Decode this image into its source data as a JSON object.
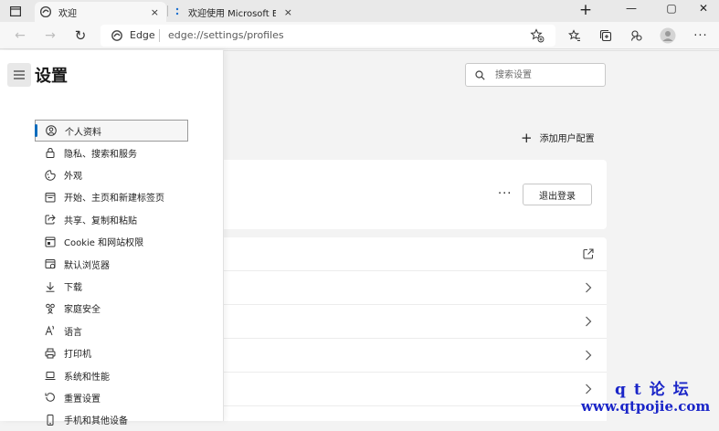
{
  "tabs": [
    {
      "title": "欢迎",
      "close": "×"
    },
    {
      "title": "欢迎使用 Microsoft Edge",
      "close": "×"
    }
  ],
  "window": {
    "new_tab": "+",
    "minimize": "—",
    "maximize": "▢",
    "close": "✕"
  },
  "nav_buttons": {
    "back": "←",
    "forward": "→",
    "refresh": "↻"
  },
  "address": {
    "brand": "Edge",
    "url": "edge://settings/profiles"
  },
  "sidebar": {
    "title": "设置",
    "items": [
      {
        "label": "个人资料",
        "icon": "profile-icon",
        "active": true
      },
      {
        "label": "隐私、搜索和服务",
        "icon": "lock-icon"
      },
      {
        "label": "外观",
        "icon": "appearance-icon"
      },
      {
        "label": "开始、主页和新建标签页",
        "icon": "home-icon"
      },
      {
        "label": "共享、复制和粘贴",
        "icon": "share-icon"
      },
      {
        "label": "Cookie 和网站权限",
        "icon": "site-permissions-icon"
      },
      {
        "label": "默认浏览器",
        "icon": "browser-icon"
      },
      {
        "label": "下载",
        "icon": "download-icon"
      },
      {
        "label": "家庭安全",
        "icon": "family-icon"
      },
      {
        "label": "语言",
        "icon": "language-icon"
      },
      {
        "label": "打印机",
        "icon": "printer-icon"
      },
      {
        "label": "系统和性能",
        "icon": "laptop-icon"
      },
      {
        "label": "重置设置",
        "icon": "reset-icon"
      },
      {
        "label": "手机和其他设备",
        "icon": "phone-icon"
      }
    ]
  },
  "search": {
    "placeholder": "搜索设置"
  },
  "profile": {
    "add_label": "添加用户配置",
    "more": "···",
    "signout_label": "退出登录"
  },
  "watermark": {
    "line1": "qt论坛",
    "line2": "www.qtpojie.com"
  },
  "colors": {
    "accent": "#0f6cbd",
    "watermark": "#1a25c8"
  }
}
